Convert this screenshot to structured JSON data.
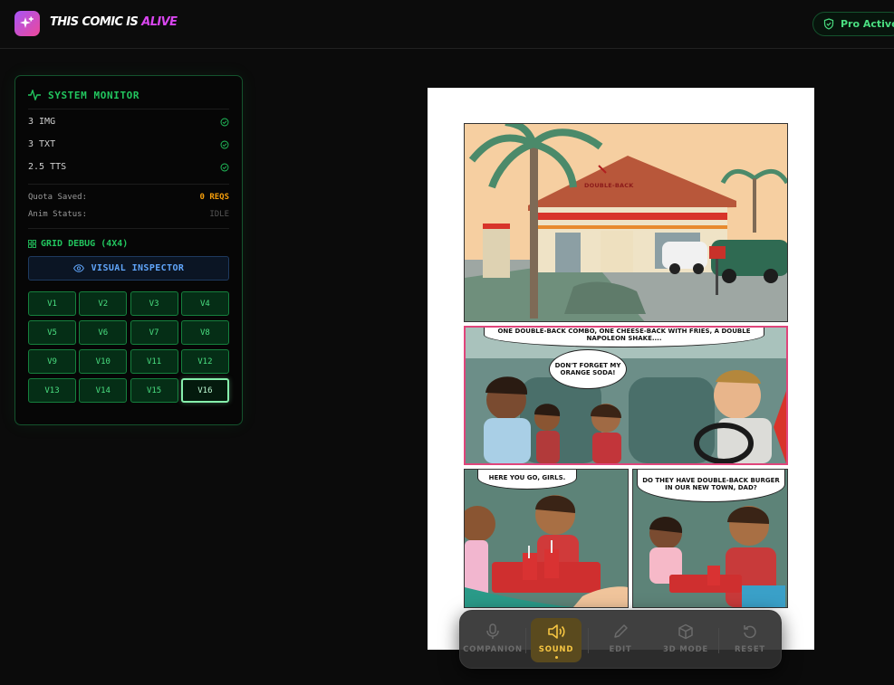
{
  "app": {
    "title_main": "THIS COMIC IS",
    "title_accent": "ALIVE",
    "pro_status": "Pro Active"
  },
  "monitor": {
    "title": "SYSTEM MONITOR",
    "stats": [
      {
        "label": "3 IMG"
      },
      {
        "label": "3 TXT"
      },
      {
        "label": "2.5 TTS"
      }
    ],
    "quota_label": "Quota Saved:",
    "quota_value": "0 REQS",
    "anim_label": "Anim Status:",
    "anim_value": "IDLE",
    "grid_title": "GRID DEBUG (4X4)",
    "inspector_label": "VISUAL INSPECTOR",
    "variants": [
      "V1",
      "V2",
      "V3",
      "V4",
      "V5",
      "V6",
      "V7",
      "V8",
      "V9",
      "V10",
      "V11",
      "V12",
      "V13",
      "V14",
      "V15",
      "V16"
    ],
    "active_variant": "V16"
  },
  "comic": {
    "sign": "DOUBLE-BACK",
    "panel2_bubble1": "ONE DOUBLE-BACK COMBO, ONE CHEESE-BACK WITH FRIES, A DOUBLE NAPOLEON SHAKE....",
    "panel2_bubble2": "DON'T FORGET MY ORANGE SODA!",
    "panel3_bubble": "HERE YOU GO, GIRLS.",
    "panel4_bubble": "DO THEY HAVE DOUBLE-BACK BURGER IN OUR NEW TOWN, DAD?"
  },
  "toolbar": {
    "items": [
      {
        "label": "COMPANION",
        "icon": "mic-icon"
      },
      {
        "label": "SOUND",
        "icon": "speaker-icon"
      },
      {
        "label": "EDIT",
        "icon": "pencil-icon"
      },
      {
        "label": "3D MODE",
        "icon": "cube-icon"
      },
      {
        "label": "RESET",
        "icon": "reset-icon"
      }
    ],
    "active": "SOUND"
  },
  "colors": {
    "accent_green": "#22c55e",
    "accent_yellow": "#f5c542",
    "brand_pink": "#ec4899",
    "inspector_blue": "#60a5fa"
  }
}
